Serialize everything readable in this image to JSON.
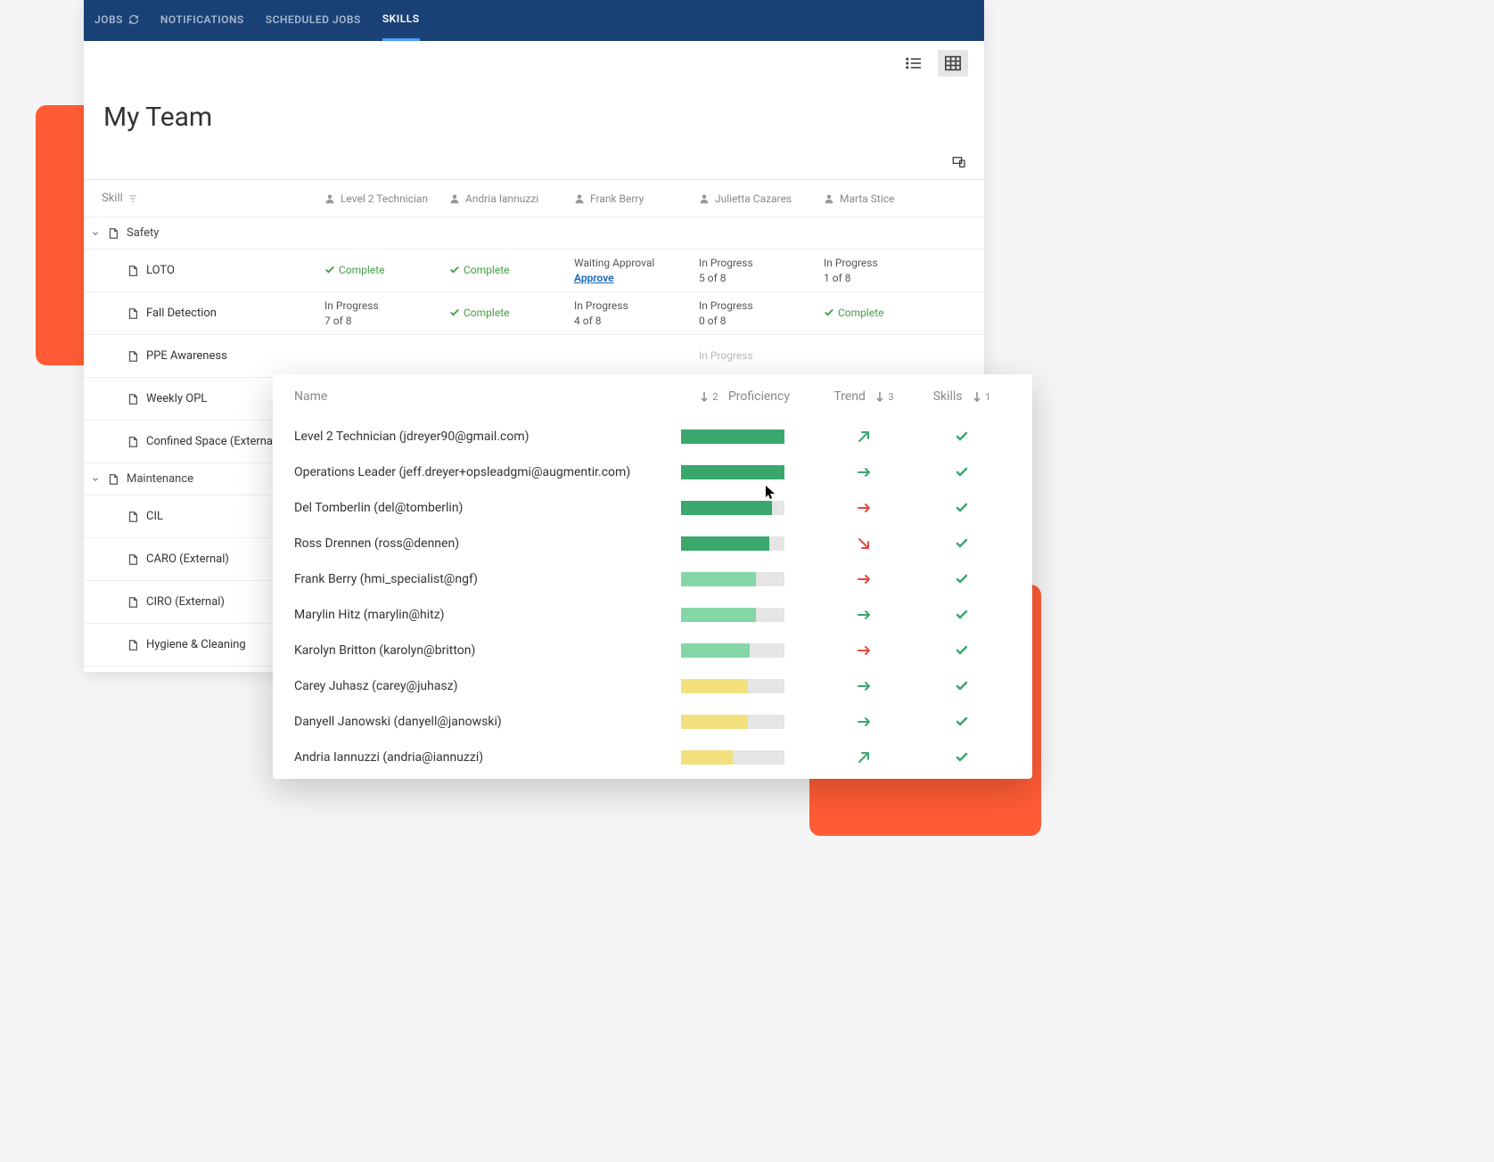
{
  "nav": {
    "jobs": "JOBS",
    "notifications": "NOTIFICATIONS",
    "scheduled": "SCHEDULED JOBS",
    "skills": "SKILLS"
  },
  "page": {
    "title": "My Team"
  },
  "grid": {
    "skill_header": "Skill",
    "columns": [
      "Level 2 Technician",
      "Andria Iannuzzi",
      "Frank Berry",
      "Julietta Cazares",
      "Marta Stice"
    ],
    "categories": [
      {
        "name": "Safety",
        "skills": [
          {
            "name": "LOTO",
            "cells": [
              {
                "type": "complete",
                "label": "Complete"
              },
              {
                "type": "complete",
                "label": "Complete"
              },
              {
                "type": "approval",
                "line1": "Waiting Approval",
                "approve": "Approve"
              },
              {
                "type": "progress",
                "line1": "In Progress",
                "line2": "5 of 8"
              },
              {
                "type": "progress",
                "line1": "In Progress",
                "line2": "1 of 8"
              }
            ]
          },
          {
            "name": "Fall Detection",
            "cells": [
              {
                "type": "progress",
                "line1": "In Progress",
                "line2": "7 of 8"
              },
              {
                "type": "complete",
                "label": "Complete"
              },
              {
                "type": "progress",
                "line1": "In Progress",
                "line2": "4 of 8"
              },
              {
                "type": "progress",
                "line1": "In Progress",
                "line2": "0 of 8"
              },
              {
                "type": "complete",
                "label": "Complete"
              }
            ]
          },
          {
            "name": "PPE Awareness",
            "cells": [
              {},
              {},
              {},
              {
                "type": "cutoff",
                "line1": "In Progress"
              },
              {}
            ]
          },
          {
            "name": "Weekly OPL",
            "cells": [
              {},
              {},
              {},
              {},
              {}
            ]
          },
          {
            "name": "Confined Space (External)",
            "cells": [
              {},
              {},
              {},
              {},
              {}
            ]
          }
        ]
      },
      {
        "name": "Maintenance",
        "skills": [
          {
            "name": "CIL",
            "cells": [
              {},
              {},
              {},
              {},
              {}
            ]
          },
          {
            "name": "CARO (External)",
            "cells": [
              {},
              {},
              {},
              {},
              {}
            ]
          },
          {
            "name": "CIRO (External)",
            "cells": [
              {},
              {},
              {},
              {},
              {}
            ]
          },
          {
            "name": "Hygiene & Cleaning",
            "cells": [
              {},
              {},
              {},
              {},
              {}
            ]
          }
        ]
      }
    ]
  },
  "overlay": {
    "headers": {
      "name": "Name",
      "proficiency": "Proficiency",
      "trend": "Trend",
      "skills": "Skills",
      "sort2": "2",
      "sort3": "3",
      "sort1": "1"
    },
    "rows": [
      {
        "name": "Level 2 Technician (jdreyer90@gmail.com)",
        "prof_pct": 100,
        "prof_color": "#3aa76d",
        "trend": "up-right",
        "trend_color": "#3aa76d",
        "skills": true
      },
      {
        "name": "Operations Leader (jeff.dreyer+opsleadgmi@augmentir.com)",
        "prof_pct": 100,
        "prof_color": "#3aa76d",
        "trend": "right",
        "trend_color": "#3aa76d",
        "skills": true
      },
      {
        "name": "Del Tomberlin (del@tomberlin)",
        "prof_pct": 88,
        "prof_color": "#3aa76d",
        "trend": "right",
        "trend_color": "#e24a42",
        "skills": true
      },
      {
        "name": "Ross Drennen (ross@dennen)",
        "prof_pct": 85,
        "prof_color": "#3aa76d",
        "trend": "down-right",
        "trend_color": "#e24a42",
        "skills": true
      },
      {
        "name": "Frank Berry (hmi_specialist@ngf)",
        "prof_pct": 72,
        "prof_color": "#85d6a6",
        "trend": "right",
        "trend_color": "#e24a42",
        "skills": true
      },
      {
        "name": "Marylin Hitz (marylin@hitz)",
        "prof_pct": 72,
        "prof_color": "#85d6a6",
        "trend": "right",
        "trend_color": "#3aa76d",
        "skills": true
      },
      {
        "name": "Karolyn Britton (karolyn@britton)",
        "prof_pct": 66,
        "prof_color": "#85d6a6",
        "trend": "right",
        "trend_color": "#e24a42",
        "skills": true
      },
      {
        "name": "Carey Juhasz (carey@juhasz)",
        "prof_pct": 65,
        "prof_color": "#f2e07c",
        "trend": "right",
        "trend_color": "#3aa76d",
        "skills": true
      },
      {
        "name": "Danyell Janowski (danyell@janowski)",
        "prof_pct": 65,
        "prof_color": "#f2e07c",
        "trend": "right",
        "trend_color": "#3aa76d",
        "skills": true
      },
      {
        "name": "Andria Iannuzzi (andria@iannuzzi)",
        "prof_pct": 50,
        "prof_color": "#f2e07c",
        "trend": "up-right",
        "trend_color": "#3aa76d",
        "skills": true
      }
    ]
  }
}
